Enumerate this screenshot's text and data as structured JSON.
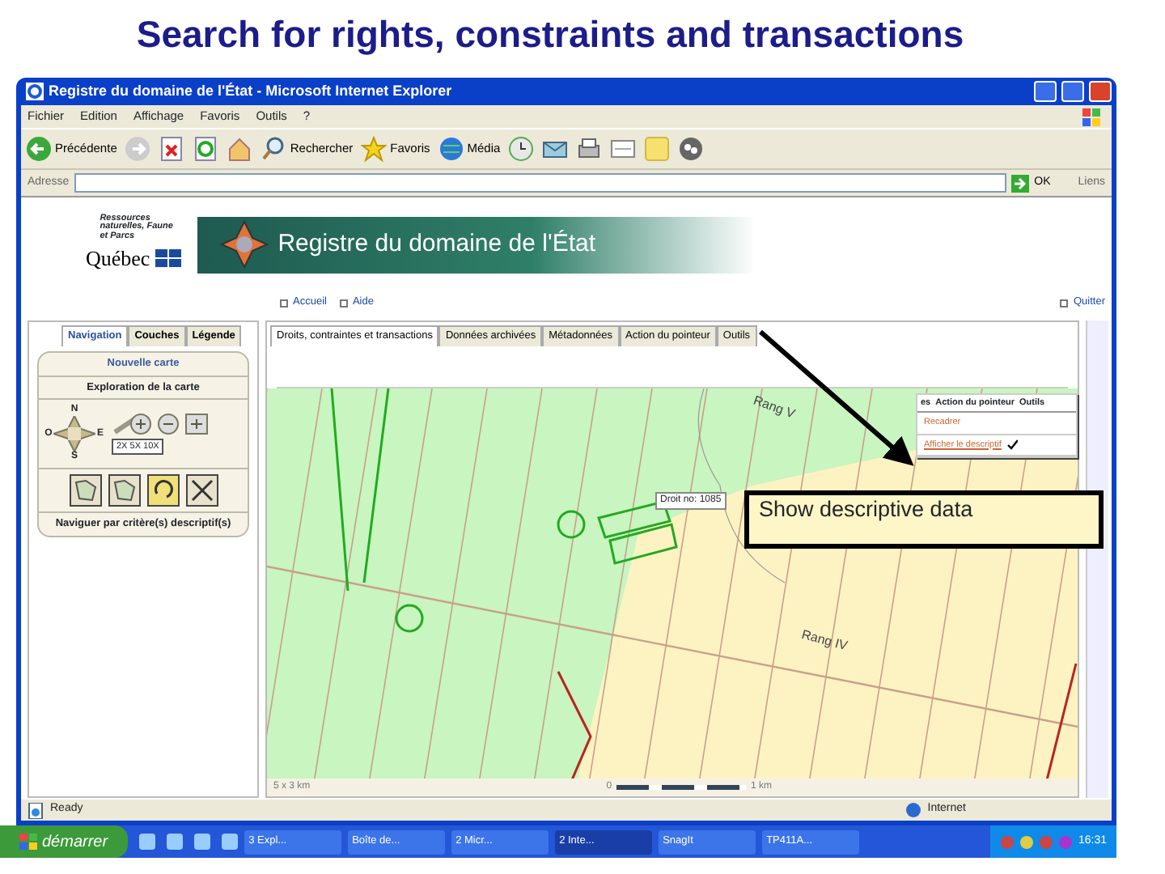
{
  "slide_title": "Search for rights, constraints and transactions",
  "window": {
    "title": "Registre du domaine de l'État - Microsoft Internet Explorer"
  },
  "menu": [
    "Fichier",
    "Edition",
    "Affichage",
    "Favoris",
    "Outils",
    "?"
  ],
  "toolbar": [
    {
      "kind": "back",
      "label": "Précédente"
    },
    {
      "kind": "forward"
    },
    {
      "kind": "stop"
    },
    {
      "kind": "refresh"
    },
    {
      "kind": "home"
    },
    {
      "kind": "search",
      "label": "Rechercher"
    },
    {
      "kind": "favorites",
      "label": "Favoris"
    },
    {
      "kind": "media",
      "label": "Média"
    },
    {
      "kind": "history"
    },
    {
      "kind": "mail"
    },
    {
      "kind": "print"
    },
    {
      "kind": "edit"
    },
    {
      "kind": "note"
    },
    {
      "kind": "messenger"
    }
  ],
  "address": {
    "label": "Adresse",
    "go": "OK",
    "links": "Liens"
  },
  "site": {
    "ministry": "Ressources naturelles, Faune et Parcs",
    "logo": "Québec",
    "banner": "Registre du domaine de l'État",
    "nav_links": [
      "Accueil",
      "Aide"
    ],
    "quit": "Quitter"
  },
  "left_tabs": [
    {
      "label": "Navigation",
      "selected": true
    },
    {
      "label": "Couches",
      "selected": false
    },
    {
      "label": "Légende",
      "selected": false
    }
  ],
  "nav_panel": {
    "new_map": "Nouvelle carte",
    "exploration": "Exploration de la carte",
    "compass": [
      "N",
      "O",
      "E",
      "S"
    ],
    "zoom_levels": "2X 5X 10X",
    "criteria": "Naviguer par critère(s) descriptif(s)"
  },
  "main_tabs": [
    {
      "label": "Droits, contraintes et transactions",
      "selected": true
    },
    {
      "label": "Données archivées",
      "selected": false
    },
    {
      "label": "Métadonnées",
      "selected": false
    },
    {
      "label": "Action du pointeur",
      "selected": false
    },
    {
      "label": "Outils",
      "selected": false
    }
  ],
  "map": {
    "labels": [
      "Rang V",
      "Rang IV"
    ],
    "tooltip": "Droit no: 1085",
    "scale": "5 x 3 km",
    "scale_start": "0",
    "scale_end": "1 km"
  },
  "popup": {
    "tabs": [
      "es",
      "Action du pointeur",
      "Outils"
    ],
    "items": [
      {
        "label": "Recadrer",
        "checked": false
      },
      {
        "label": "Afficher le descriptif",
        "checked": true
      }
    ]
  },
  "callout": "Show descriptive data",
  "status": {
    "text": "Ready",
    "zone": "Internet"
  },
  "taskbar": {
    "start": "démarrer",
    "tasks": [
      {
        "label": "3 Expl...",
        "selected": false
      },
      {
        "label": "Boîte de...",
        "selected": false
      },
      {
        "label": "2 Micr...",
        "selected": false
      },
      {
        "label": "2 Inte...",
        "selected": true
      },
      {
        "label": "SnagIt",
        "selected": false
      },
      {
        "label": "TP411A...",
        "selected": false
      }
    ],
    "clock": "16:31"
  }
}
